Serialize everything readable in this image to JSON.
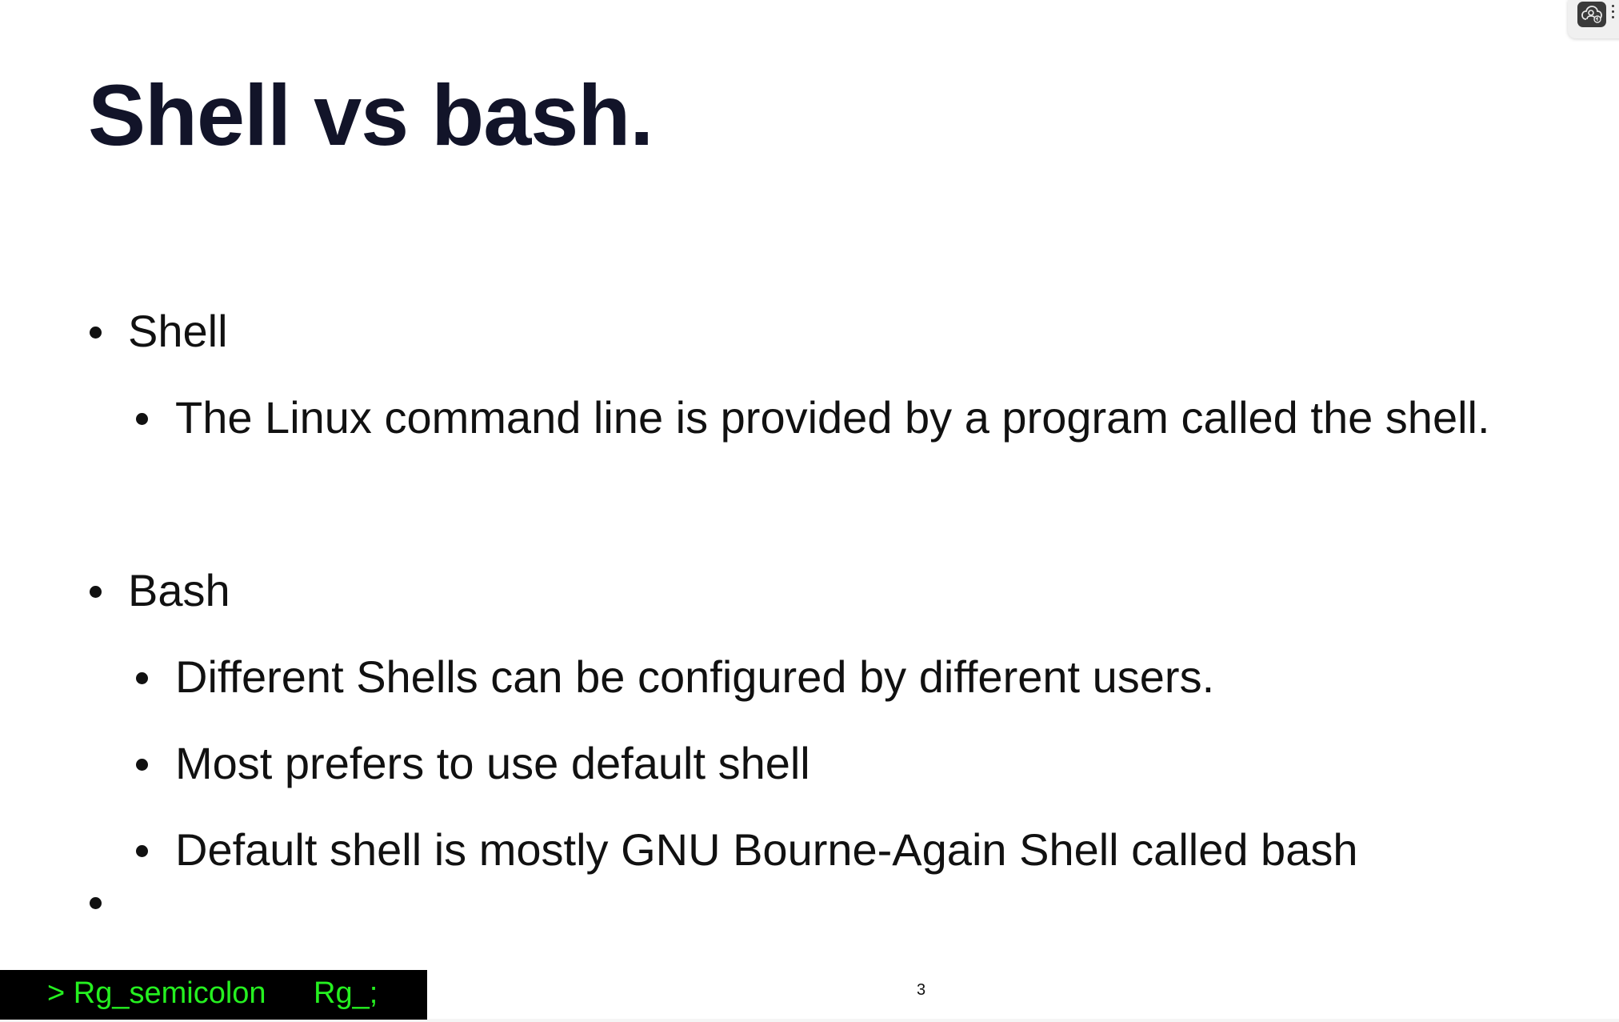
{
  "slide": {
    "title": "Shell vs bash.",
    "bullets": [
      {
        "label": "Shell",
        "children": [
          "The Linux command line is provided by a program called the shell."
        ]
      },
      {
        "label": "Bash",
        "children": [
          "Different Shells can be configured by different users.",
          "Most prefers to use default shell",
          "Default shell is mostly GNU Bourne-Again Shell called bash"
        ]
      }
    ],
    "empty_bullet": "",
    "page_number": "3"
  },
  "brand": {
    "left": "> Rg_semicolon",
    "right": "Rg_;",
    "color": "#25f020",
    "background": "#000000"
  },
  "widget": {
    "icon": "cloud-user-sync-icon",
    "menu_icon": "more-options-icon"
  },
  "colors": {
    "title": "#121429",
    "text": "#111111",
    "slide_background": "#ffffff"
  }
}
